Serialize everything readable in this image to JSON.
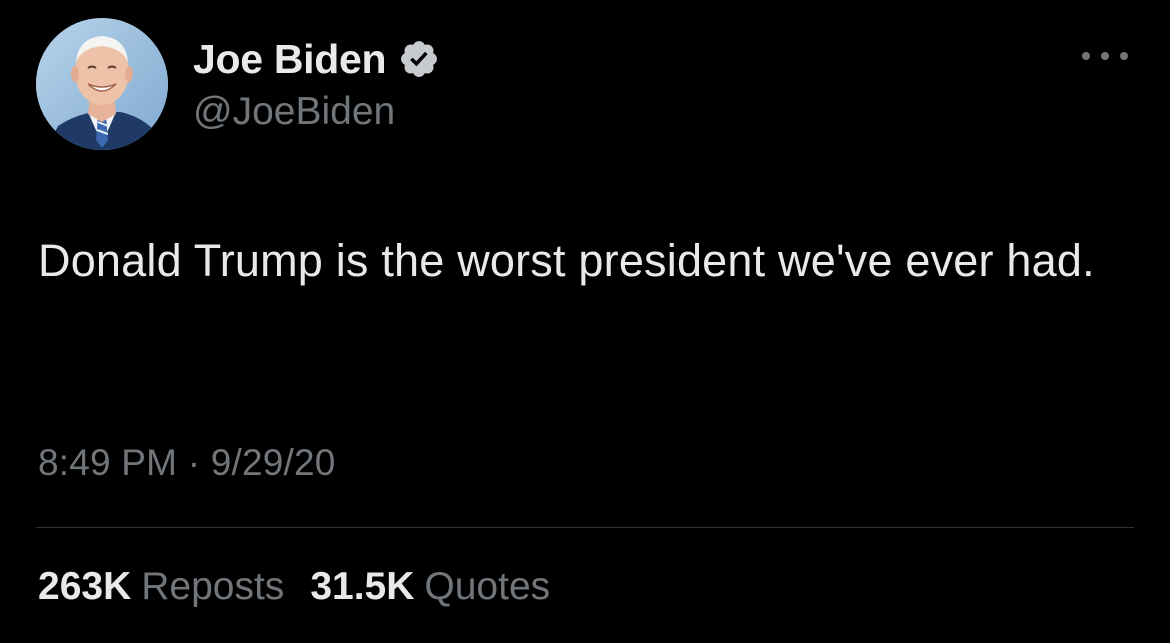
{
  "author": {
    "display_name": "Joe Biden",
    "handle": "@JoeBiden",
    "verified": true,
    "verified_color": "#1d9bf0",
    "avatar_icon": "profile-photo"
  },
  "more_icon": "ellipsis-icon",
  "tweet": {
    "text": "Donald Trump is the worst president we've ever had.",
    "time": "8:49 PM",
    "separator": "·",
    "date": "9/29/20"
  },
  "stats": {
    "reposts_count": "263K",
    "reposts_label": "Reposts",
    "quotes_count": "31.5K",
    "quotes_label": "Quotes"
  },
  "colors": {
    "background": "#000000",
    "primary_text": "#e7e9ea",
    "secondary_text": "#71767b",
    "divider": "#2f3336"
  }
}
